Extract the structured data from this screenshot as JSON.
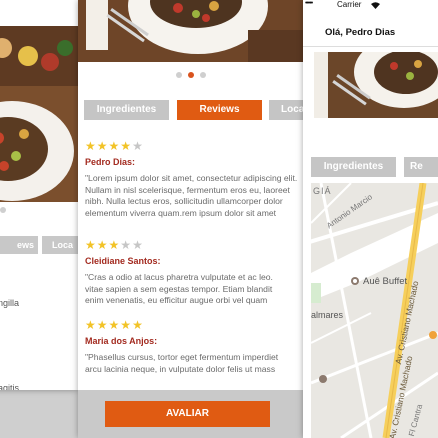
{
  "left_screen": {
    "tabs": [
      "Reviews",
      "Localização"
    ],
    "visible_tab_text": [
      "ews",
      "Loca"
    ],
    "text_lines": [
      "ngilla",
      "agitis"
    ]
  },
  "middle_screen": {
    "carousel_dots": [
      false,
      true,
      false
    ],
    "tabs": [
      {
        "label": "Ingredientes",
        "active": false
      },
      {
        "label": "Reviews",
        "active": true
      },
      {
        "label": "Loca",
        "active": false
      }
    ],
    "reviews": [
      {
        "rating": 4,
        "max": 5,
        "name": "Pedro Dias:",
        "lines": [
          "\"Lorem ipsum dolor sit amet, consectetur adipiscing elit.",
          "Nullam in nisl scelerisque, fermentum eros eu, laoreet",
          "nibh. Nulla lectus eros, sollicitudin ullamcorper dolor",
          "elementum viverra quam.rem ipsum dolor sit amet"
        ]
      },
      {
        "rating": 3,
        "max": 5,
        "name": "Cleidiane Santos:",
        "lines": [
          "\"Cras a odio at lacus pharetra vulputate et ac leo.",
          "vitae sapien a sem egestas tempor. Etiam blandit",
          "enim venenatis, eu efficitur augue orbi vel quam"
        ]
      },
      {
        "rating": 5,
        "max": 5,
        "name": "Maria dos Anjos:",
        "lines": [
          "\"Phasellus cursus, tortor eget fermentum imperdiet",
          "arcu lacinia neque, in vulputate dolor felis ut mass"
        ]
      }
    ],
    "evaluate_button": "AVALIAR"
  },
  "right_screen": {
    "status": {
      "carrier": "Carrier",
      "signal": "•••••",
      "wifi": "wifi-icon"
    },
    "greeting": "Olá, Pedro Dias",
    "tabs": [
      "Ingredientes",
      "Re"
    ],
    "map": {
      "labels": [
        {
          "text": "GIÁ",
          "kind": "district"
        },
        {
          "text": "Antonio Marcio",
          "kind": "street"
        },
        {
          "text": "Auê Buffet",
          "kind": "poi"
        },
        {
          "text": "Av. Cristiano Machado",
          "kind": "avenue"
        },
        {
          "text": "almares",
          "kind": "district"
        },
        {
          "text": "Av. Cristiano Machado",
          "kind": "avenue"
        },
        {
          "text": "Fl Cantra",
          "kind": "street"
        }
      ]
    }
  },
  "colors": {
    "accent": "#e05b12",
    "name_red": "#a32b20",
    "star": "#f2c327",
    "tab_grey": "#c5c5c5"
  }
}
